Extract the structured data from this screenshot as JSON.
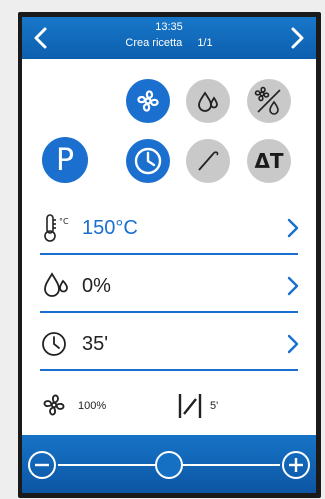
{
  "header": {
    "time": "13:35",
    "title": "Crea ricetta",
    "page": "1/1"
  },
  "mode_buttons": {
    "p_label": "P",
    "delta_t_label": "ΔT"
  },
  "params": {
    "temperature": "150°C",
    "humidity": "0%",
    "time": "35'"
  },
  "footer": {
    "fan_speed": "100%",
    "probe_value": "5'"
  },
  "slider": {
    "level": 0.5
  },
  "colors": {
    "accent": "#1a6fcf",
    "inactive": "#c9c9c9"
  }
}
